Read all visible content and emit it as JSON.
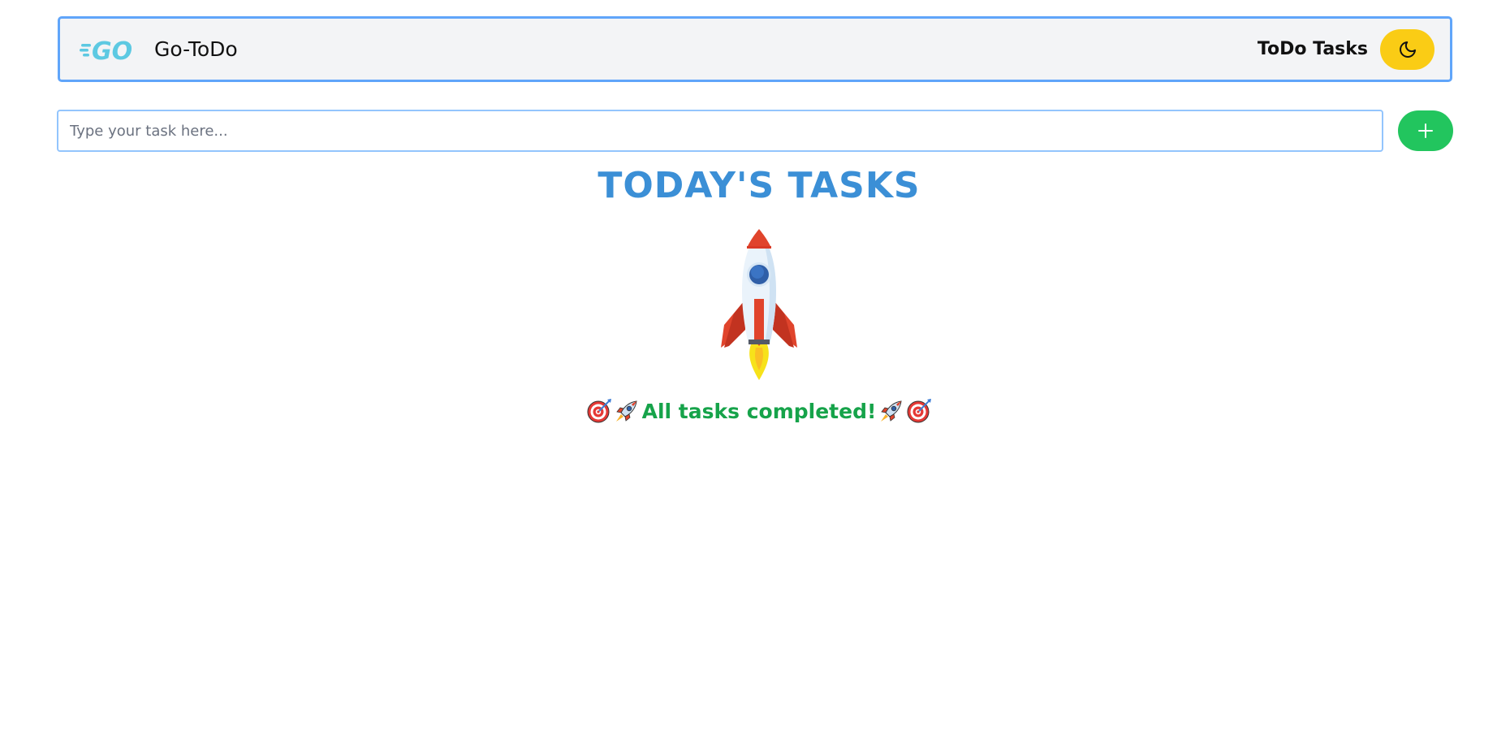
{
  "header": {
    "logo_icon": "go-logo-icon",
    "app_name": "Go-ToDo",
    "nav_link": "ToDo Tasks",
    "theme_toggle_icon": "moon-icon",
    "accent_color": "#60a5fa",
    "theme_button_color": "#facc15"
  },
  "task_form": {
    "input_value": "",
    "placeholder": "Type your task here...",
    "add_button_icon": "plus-icon",
    "add_button_color": "#22c55e"
  },
  "main": {
    "title": "TODAY'S TASKS",
    "illustration": "rocket-icon",
    "empty_state": {
      "message": "All tasks completed!",
      "leading_icons": [
        "target-icon",
        "rocket-icon"
      ],
      "trailing_icons": [
        "rocket-icon",
        "target-icon"
      ],
      "color": "#16a34a"
    },
    "title_color": "#3b8fd6"
  }
}
